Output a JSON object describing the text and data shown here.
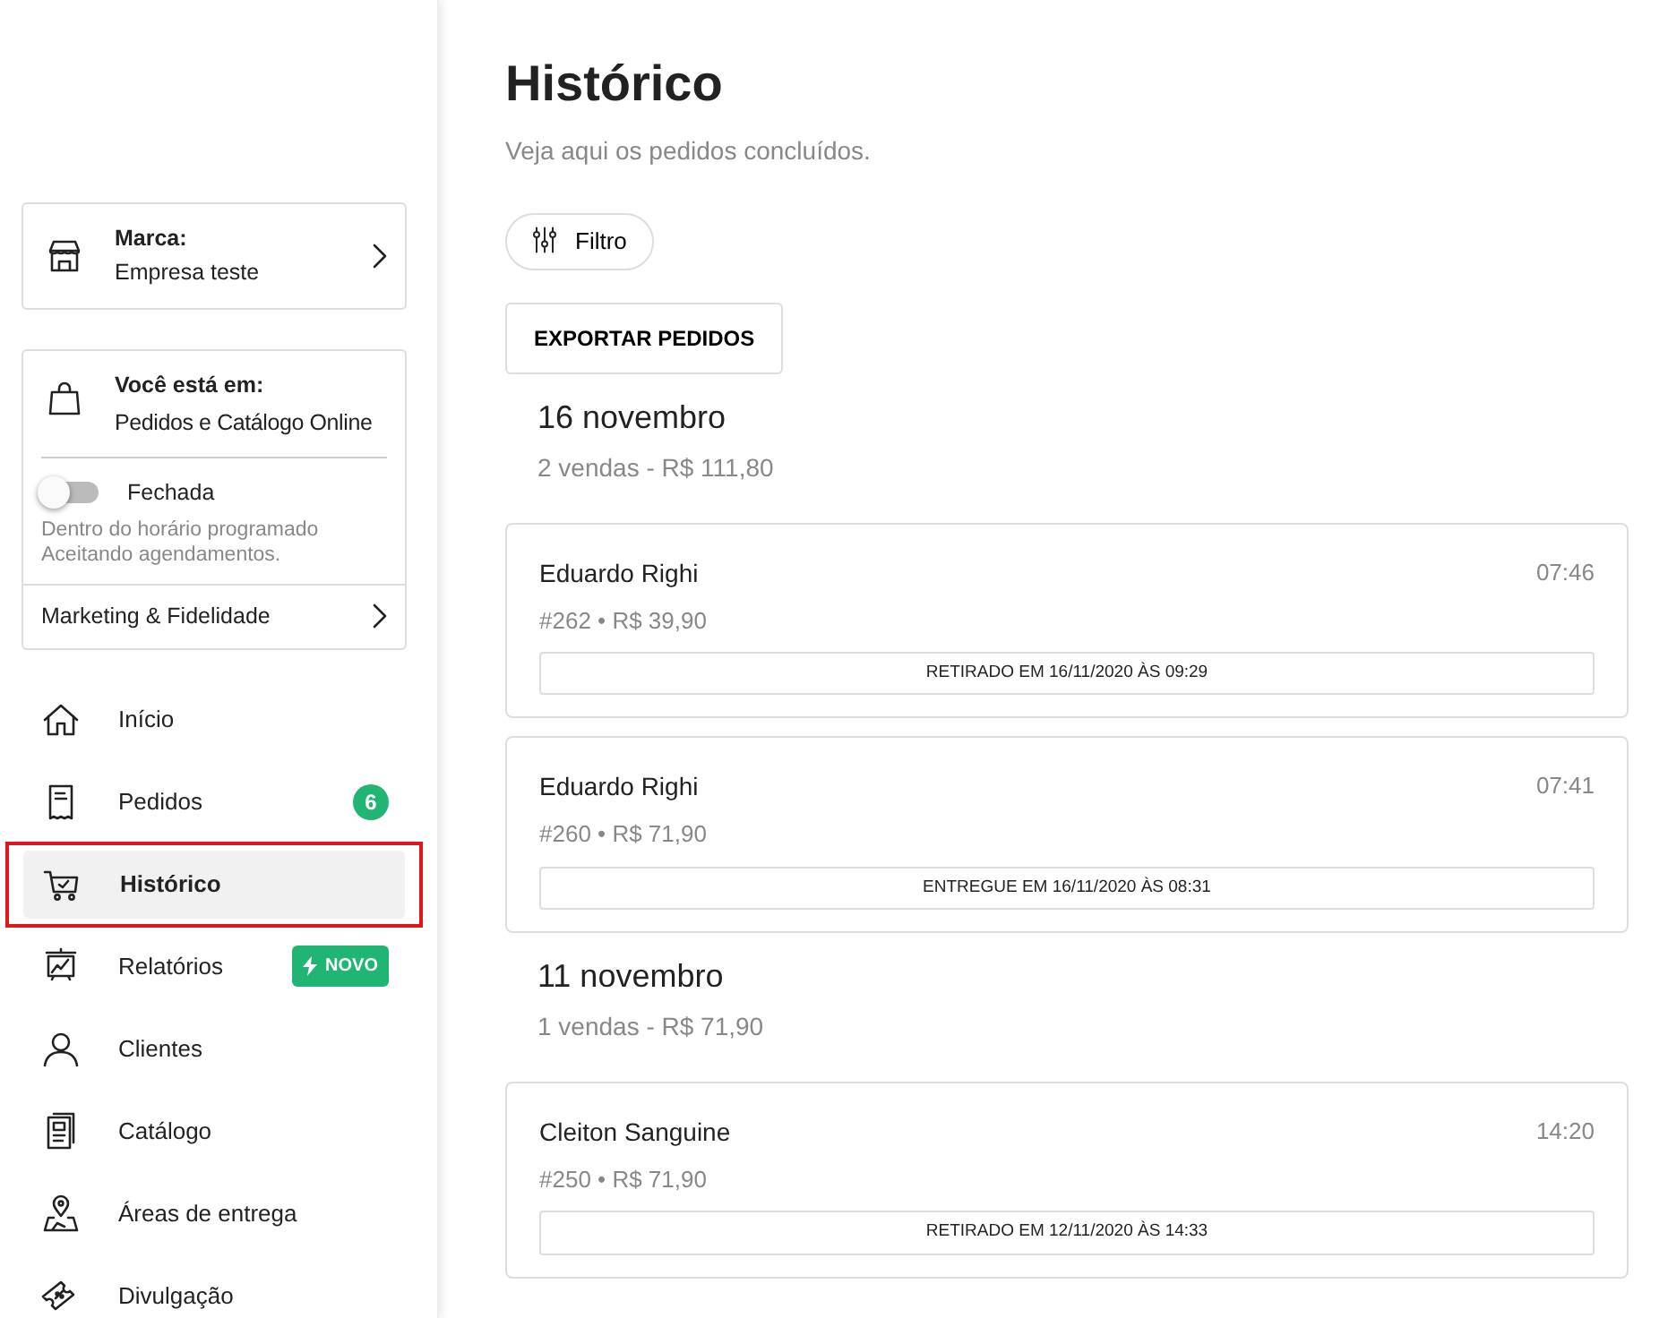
{
  "sidebar": {
    "brand": {
      "label": "Marca:",
      "value": "Empresa teste"
    },
    "location": {
      "label": "Você está em:",
      "value": "Pedidos e Catálogo Online",
      "store_open": false,
      "store_status": "Fechada",
      "notes": [
        "Dentro do horário programado",
        "Aceitando agendamentos."
      ],
      "link": "Marketing & Fidelidade"
    },
    "items": [
      {
        "kind": "home",
        "label": "Início",
        "selected": false,
        "outlined": false
      },
      {
        "kind": "receipt",
        "label": "Pedidos",
        "selected": false,
        "outlined": false,
        "badge": {
          "kind": "count",
          "text": "6"
        }
      },
      {
        "kind": "cart",
        "label": "Histórico",
        "selected": true,
        "outlined": true
      },
      {
        "kind": "chart",
        "label": "Relatórios",
        "selected": false,
        "outlined": false,
        "badge": {
          "kind": "new",
          "text": "NOVO"
        }
      },
      {
        "kind": "user",
        "label": "Clientes",
        "selected": false,
        "outlined": false
      },
      {
        "kind": "catalog",
        "label": "Catálogo",
        "selected": false,
        "outlined": false
      },
      {
        "kind": "map",
        "label": "Áreas de entrega",
        "selected": false,
        "outlined": false
      },
      {
        "kind": "ticket",
        "label": "Divulgação",
        "selected": false,
        "outlined": false
      }
    ]
  },
  "main": {
    "title": "Histórico",
    "subtitle": "Veja aqui os pedidos concluídos.",
    "filter_button": "Filtro",
    "export_button": "EXPORTAR PEDIDOS",
    "groups": [
      {
        "date": "16 novembro",
        "summary": "2 vendas - R$ 111,80",
        "orders": [
          {
            "customer": "Eduardo Righi",
            "time": "07:46",
            "details": "#262 • R$ 39,90",
            "status": "RETIRADO EM 16/11/2020 ÀS 09:29"
          },
          {
            "customer": "Eduardo Righi",
            "time": "07:41",
            "details": "#260 • R$ 71,90",
            "status": "ENTREGUE EM 16/11/2020 ÀS 08:31"
          }
        ]
      },
      {
        "date": "11 novembro",
        "summary": "1 vendas - R$ 71,90",
        "orders": [
          {
            "customer": "Cleiton Sanguine",
            "time": "14:20",
            "details": "#250 • R$ 71,90",
            "status": "RETIRADO EM 12/11/2020 ÀS 14:33"
          }
        ]
      }
    ]
  }
}
